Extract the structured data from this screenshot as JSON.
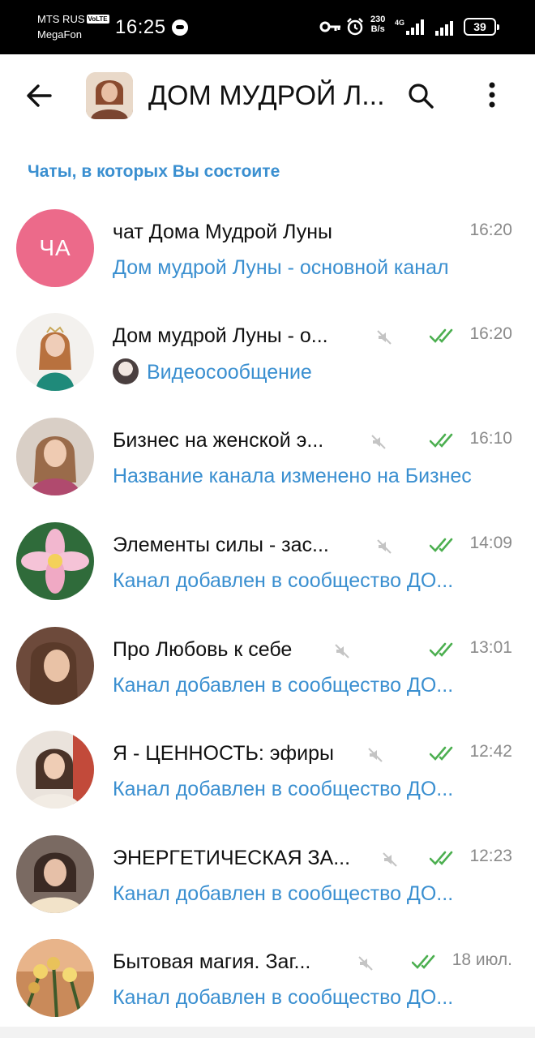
{
  "status_bar": {
    "carrier_1": "MTS RUS",
    "volte": "VoLTE",
    "carrier_2": "MegaFon",
    "time": "16:25",
    "net_speed_value": "230",
    "net_speed_unit": "B/s",
    "network_type": "4G",
    "battery": "39"
  },
  "header": {
    "title": "ДОМ МУДРОЙ Л...",
    "back_icon": "arrow-left-icon",
    "search_icon": "search-icon",
    "more_icon": "more-vertical-icon"
  },
  "section_label": "Чаты, в которых Вы состоите",
  "colors": {
    "accent": "#3a8fd0",
    "check": "#4caf50",
    "time": "#8a8a8a",
    "avatar_pink": "#ec6a8a"
  },
  "chats": [
    {
      "title": "чат Дома Мудрой Луны",
      "initials": "ЧА",
      "muted": false,
      "read": false,
      "time": "16:20",
      "preview": "Дом мудрой Луны - основной канал"
    },
    {
      "title": "Дом мудрой Луны - о...",
      "muted": true,
      "read": true,
      "time": "16:20",
      "preview": "Видеосообщение",
      "preview_has_avatar": true
    },
    {
      "title": "Бизнес на женской э...",
      "muted": true,
      "read": true,
      "time": "16:10",
      "preview": "Название канала изменено на Бизнес"
    },
    {
      "title": "Элементы силы - зас...",
      "muted": true,
      "read": true,
      "time": "14:09",
      "preview": "Канал добавлен в сообщество ДО..."
    },
    {
      "title": "Про Любовь к себе",
      "muted": true,
      "read": true,
      "time": "13:01",
      "preview": "Канал добавлен в сообщество ДО..."
    },
    {
      "title": "Я - ЦЕННОСТЬ: эфиры",
      "muted": true,
      "read": true,
      "time": "12:42",
      "preview": "Канал добавлен в сообщество ДО..."
    },
    {
      "title": "ЭНЕРГЕТИЧЕСКАЯ ЗА...",
      "muted": true,
      "read": true,
      "time": "12:23",
      "preview": "Канал добавлен в сообщество ДО..."
    },
    {
      "title": "Бытовая магия. Заг...",
      "muted": true,
      "read": true,
      "time": "18 июл.",
      "preview": "Канал добавлен в сообщество ДО..."
    }
  ]
}
